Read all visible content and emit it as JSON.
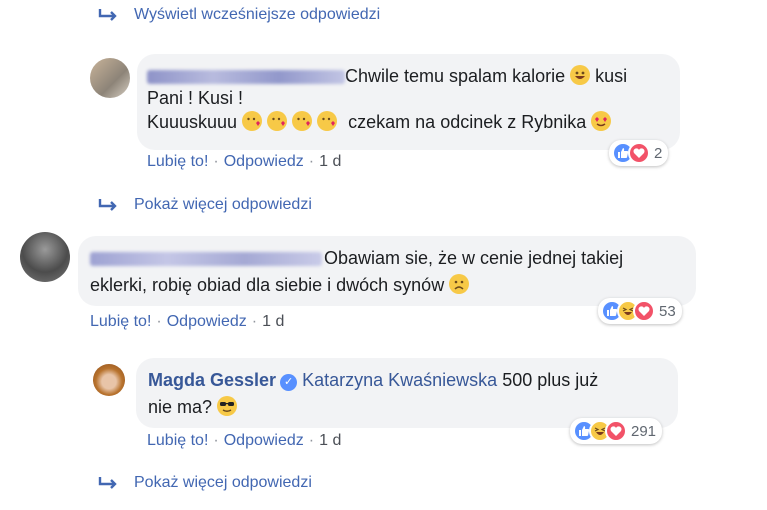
{
  "links": {
    "show_earlier": "Wyświetl wcześniejsze odpowiedzi",
    "show_more_1": "Pokaż więcej odpowiedzi",
    "show_more_2": "Pokaż więcej odpowiedzi"
  },
  "comment1": {
    "text_line1": "Chwile temu spalam kalorie",
    "text_line1_end": "kusi",
    "text_line2": "Pani ! Kusi !",
    "text_line3a": "Kuuuskuuu",
    "text_line3b": "czekam na odcinek z Rybnika",
    "like": "Lubię to!",
    "reply": "Odpowiedz",
    "time": "1 d",
    "reaction_count": "2"
  },
  "comment2": {
    "text_line1": "Obawiam sie, że w cenie jednej takiej",
    "text_line2": "eklerki, robię obiad dla siebie i dwóch synów",
    "like": "Lubię to!",
    "reply": "Odpowiedz",
    "time": "1 d",
    "reaction_count": "53"
  },
  "comment3": {
    "author": "Magda Gessler",
    "tagged": "Katarzyna Kwaśniewska",
    "text_line1": "500 plus już",
    "text_line2": "nie ma?",
    "like": "Lubię to!",
    "reply": "Odpowiedz",
    "time": "1 d",
    "reaction_count": "291"
  },
  "icons": {
    "reply_arrow": "reply-arrow-icon",
    "like": "like-reaction-icon",
    "love": "love-reaction-icon",
    "haha": "haha-reaction-icon",
    "verified": "verified-badge-icon"
  },
  "colors": {
    "link": "#4267b2",
    "name": "#385898",
    "bubble": "#f2f3f5",
    "like": "#5890ff",
    "love": "#f25268",
    "haha": "#f7c947"
  }
}
